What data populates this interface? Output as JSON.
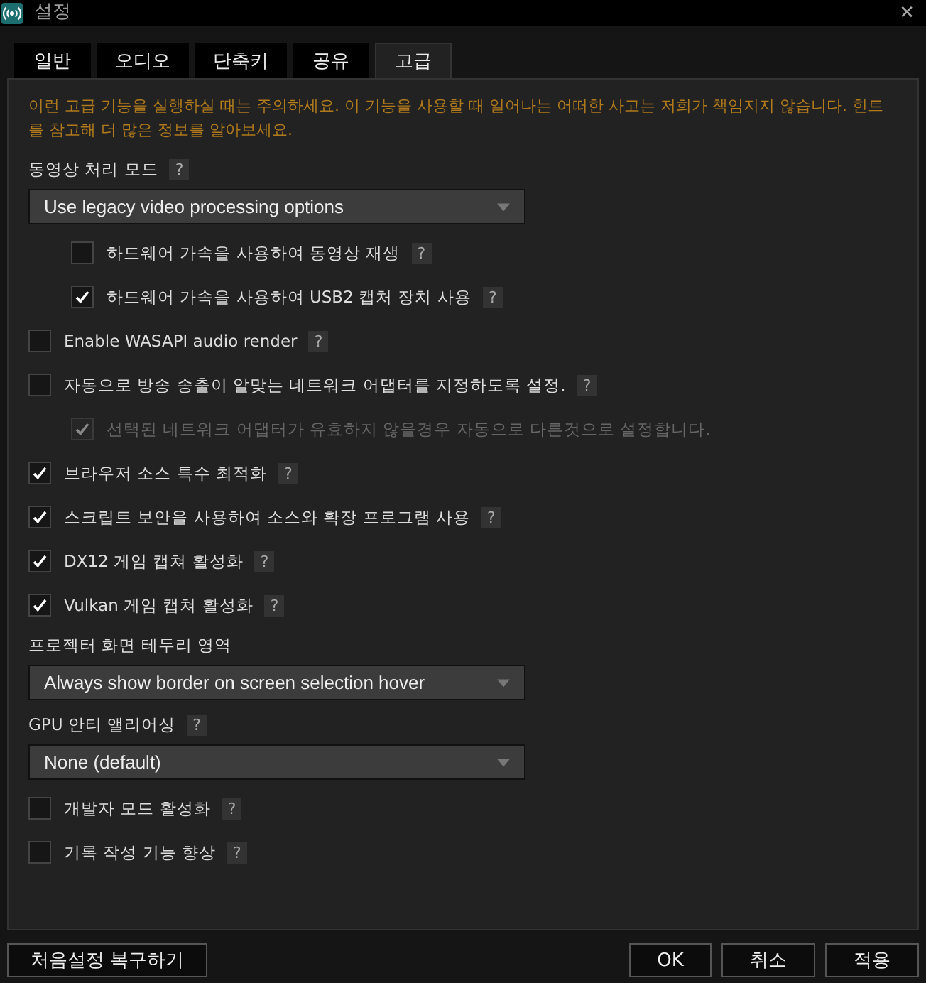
{
  "window": {
    "title": "설정",
    "close": "✕"
  },
  "tabs": [
    {
      "label": "일반",
      "selected": false
    },
    {
      "label": "오디오",
      "selected": false
    },
    {
      "label": "단축키",
      "selected": false
    },
    {
      "label": "공유",
      "selected": false
    },
    {
      "label": "고급",
      "selected": true
    }
  ],
  "warning": "이런 고급 기능을 실행하실 때는 주의하세요. 이 기능을 사용할 때 일어나는 어떠한 사고는 저희가 책임지지 않습니다. 힌트를 참고해 더 많은 정보를 알아보세요.",
  "settings": [
    {
      "kind": "heading",
      "label": "동영상 처리 모드",
      "help": "?"
    },
    {
      "kind": "dropdown",
      "value": "Use legacy video processing options"
    },
    {
      "kind": "checkbox",
      "label": "하드웨어 가속을 사용하여 동영상 재생",
      "help": "?",
      "checked": false,
      "disabled": false,
      "indented": true
    },
    {
      "kind": "checkbox",
      "label": "하드웨어 가속을 사용하여 USB2 캡처 장치 사용",
      "help": "?",
      "checked": true,
      "disabled": false,
      "indented": true
    },
    {
      "kind": "checkbox",
      "label": "Enable WASAPI audio render",
      "help": "?",
      "checked": false,
      "disabled": false,
      "indented": false
    },
    {
      "kind": "checkbox",
      "label": "자동으로 방송 송출이 알맞는 네트워크 어댑터를 지정하도록 설정.",
      "help": "?",
      "checked": false,
      "disabled": false,
      "indented": false
    },
    {
      "kind": "checkbox",
      "label": "선택된 네트워크 어댑터가 유효하지 않을경우 자동으로 다른것으로 설정합니다.",
      "checked": true,
      "disabled": true,
      "indented": true
    },
    {
      "kind": "checkbox",
      "label": "브라우저 소스 특수 최적화",
      "help": "?",
      "checked": true,
      "disabled": false,
      "indented": false
    },
    {
      "kind": "checkbox",
      "label": "스크립트 보안을 사용하여 소스와 확장 프로그램 사용",
      "help": "?",
      "checked": true,
      "disabled": false,
      "indented": false
    },
    {
      "kind": "checkbox",
      "label": "DX12 게임 캡쳐 활성화",
      "help": "?",
      "checked": true,
      "disabled": false,
      "indented": false
    },
    {
      "kind": "checkbox",
      "label": "Vulkan 게임 캡쳐 활성화",
      "help": "?",
      "checked": true,
      "disabled": false,
      "indented": false
    },
    {
      "kind": "heading",
      "label": "프로젝터 화면 테두리 영역"
    },
    {
      "kind": "dropdown",
      "value": "Always show border on screen selection hover"
    },
    {
      "kind": "heading",
      "label": "GPU 안티 앨리어싱",
      "help": "?"
    },
    {
      "kind": "dropdown",
      "value": "None (default)"
    },
    {
      "kind": "checkbox",
      "label": "개발자 모드 활성화",
      "help": "?",
      "checked": false,
      "disabled": false,
      "indented": false
    },
    {
      "kind": "checkbox",
      "label": "기록 작성 기능 향상",
      "help": "?",
      "checked": false,
      "disabled": false,
      "indented": false
    }
  ],
  "footer": {
    "reset": "처음설정 복구하기",
    "buttons": [
      "OK",
      "취소",
      "적용"
    ]
  }
}
